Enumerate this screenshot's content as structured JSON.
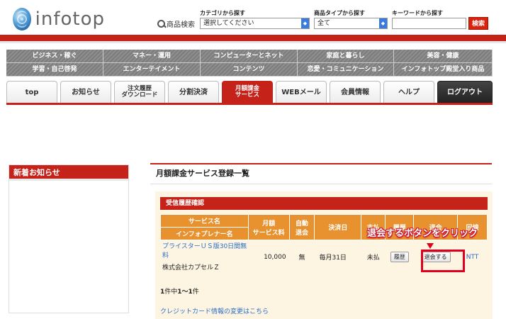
{
  "header": {
    "logo_text": "infotop",
    "product_search_label": "商品検索",
    "category_label": "カテゴリから探す",
    "category_select": "選択してください",
    "type_label": "商品タイプから探す",
    "type_select": "全て",
    "keyword_label": "キーワードから探す",
    "keyword_value": "",
    "search_button": "検索"
  },
  "category_nav": [
    "ビジネス・稼ぐ",
    "マネー・運用",
    "コンピューターとネット",
    "家庭と暮らし",
    "美容・健康",
    "学習・自己啓発",
    "エンターテイメント",
    "コンテンツ",
    "恋愛・コミュニケーション",
    "インフォトップ殿堂入り商品"
  ],
  "tabs": {
    "top": "top",
    "news": "お知らせ",
    "order_history_1": "注文履歴",
    "order_history_2": "ダウンロード",
    "installment": "分割決済",
    "monthly_1": "月額課金",
    "monthly_2": "サービス",
    "webmail": "WEBメール",
    "member": "会員情報",
    "help": "ヘルプ",
    "logout": "ログアウト"
  },
  "sidebar": {
    "title": "新着お知らせ"
  },
  "main": {
    "title": "月額課金サービス登録一覧",
    "panel_title": "受信履歴確認",
    "columns": {
      "service_name": "サービス名",
      "infopreneur": "インフォプレナー名",
      "monthly_fee_1": "月額",
      "monthly_fee_2": "サービス料",
      "auto_1": "自動",
      "auto_2": "退会",
      "settlement_date": "決済日",
      "status": "支払",
      "history": "履歴",
      "cancel": "退会",
      "carrier": "回線"
    },
    "row": {
      "service_name": "プライスターＵＳ版30日間無料",
      "infopreneur": "株式会社カプセルＺ",
      "fee": "10,000",
      "auto": "無",
      "settlement_date": "毎月31日",
      "status": "未払",
      "history_button": "履歴",
      "cancel_button": "退会する",
      "carrier": "NTT"
    },
    "callout": "退会するボタンをクリック",
    "result_count_prefix": "1",
    "result_count_mid": "件中",
    "result_count_range": "1〜1",
    "result_count_suffix": "件",
    "credit_card_link": "クレジットカード情報の変更はこちら"
  },
  "colors": {
    "brand_red": "#c5221a",
    "table_orange": "#e8912f",
    "panel_bg": "#fdf4e2",
    "link_blue": "#2a6fc7"
  }
}
